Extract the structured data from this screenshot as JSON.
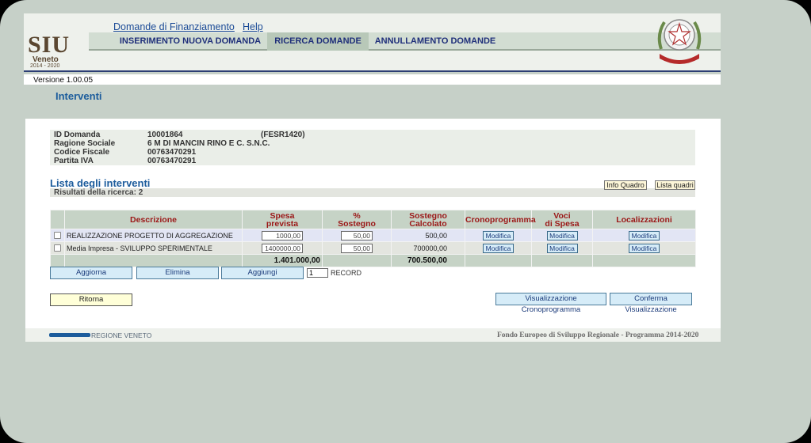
{
  "header": {
    "logo_main": "SIU",
    "logo_region": "Veneto",
    "logo_years": "2014 - 2020",
    "top_links": [
      "Domande di Finanziamento",
      "Help"
    ],
    "nav": [
      "INSERIMENTO NUOVA DOMANDA",
      "RICERCA DOMANDE",
      "ANNULLAMENTO DOMANDE"
    ],
    "version": "Versione 1.00.05"
  },
  "page": {
    "title": "Interventi"
  },
  "info": {
    "id_label": "ID Domanda",
    "id_value": "10001864",
    "id_extra": "(FESR1420)",
    "ragione_label": "Ragione Sociale",
    "ragione_value": "6 M DI MANCIN RINO E C. S.N.C.",
    "cf_label": "Codice Fiscale",
    "cf_value": "00763470291",
    "piva_label": "Partita IVA",
    "piva_value": "00763470291"
  },
  "list": {
    "title": "Lista degli interventi",
    "results": "Risultati della ricerca:   2",
    "btn_info_quadro": "Info Quadro",
    "btn_lista_quadri": "Lista quadri"
  },
  "table": {
    "headers": {
      "descrizione": "Descrizione",
      "spesa_1": "Spesa",
      "spesa_2": "prevista",
      "perc_1": "%",
      "perc_2": "Sostegno",
      "calc_1": "Sostegno",
      "calc_2": "Calcolato",
      "crono": "Cronoprogramma",
      "voci_1": "Voci",
      "voci_2": "di Spesa",
      "local": "Localizzazioni"
    },
    "rows": [
      {
        "descrizione": "REALIZZAZIONE PROGETTO DI AGGREGAZIONE",
        "spesa": "1000,00",
        "perc": "50,00",
        "calcolato": "500,00",
        "crono": "Modifica",
        "voci": "Modifica",
        "local": "Modifica"
      },
      {
        "descrizione": "Media Impresa - SVILUPPO SPERIMENTALE",
        "spesa": "1400000,00",
        "perc": "50,00",
        "calcolato": "700000,00",
        "crono": "Modifica",
        "voci": "Modifica",
        "local": "Modifica"
      }
    ],
    "totals": {
      "spesa": "1.401.000,00",
      "calcolato": "700.500,00"
    }
  },
  "actions": {
    "aggiorna": "Aggiorna",
    "elimina": "Elimina",
    "aggiungi": "Aggiungi",
    "record_value": "1",
    "record_label": "RECORD",
    "ritorna": "Ritorna",
    "vis_crono": "Visualizzazione Cronoprogramma",
    "conferma": "Conferma Visualizzazione"
  },
  "footer": {
    "left": "REGIONE VENETO",
    "right": "Fondo Europeo di Sviluppo Regionale - Programma 2014-2020"
  },
  "colors": {
    "brand_blue": "#1c5c9c",
    "header_red": "#9b1717",
    "logo_brown": "#5a4630"
  }
}
